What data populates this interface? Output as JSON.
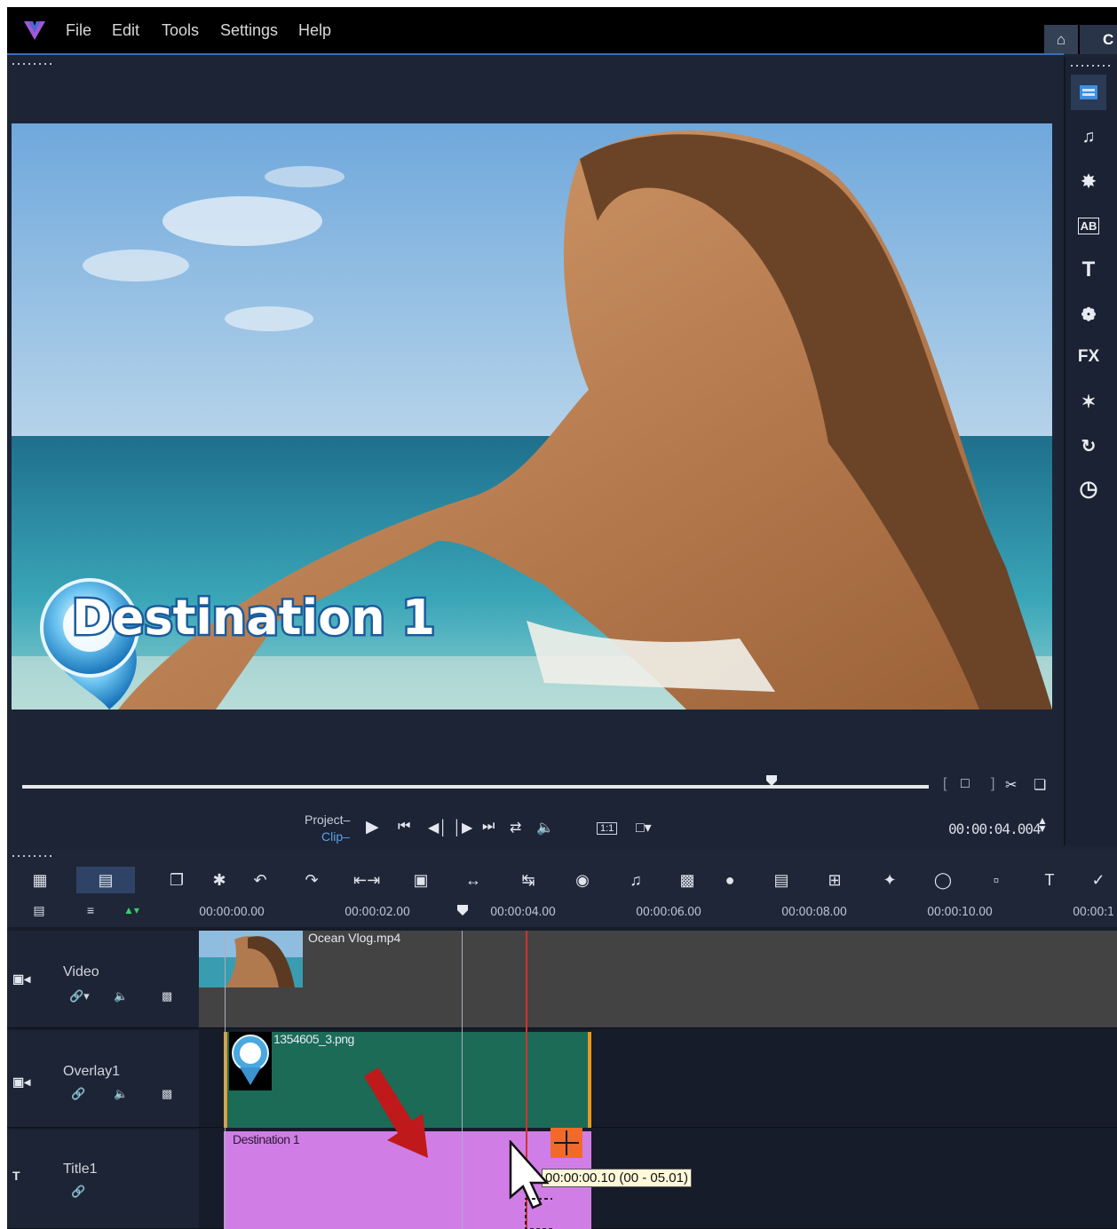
{
  "menu": {
    "items": [
      {
        "label": "File"
      },
      {
        "label": "Edit"
      },
      {
        "label": "Tools"
      },
      {
        "label": "Settings"
      },
      {
        "label": "Help"
      }
    ],
    "next_tab_letter": "C"
  },
  "player": {
    "overlay_title": "Destination 1",
    "project_label": "Project–",
    "clip_label": "Clip–",
    "timecode": "00:00:04.004",
    "aspect_label": "1:1"
  },
  "sidebar": {
    "items": [
      {
        "icon": "media-library-icon"
      },
      {
        "icon": "music-icon"
      },
      {
        "icon": "instant-project-icon"
      },
      {
        "icon": "transition-icon",
        "glyph": "AB"
      },
      {
        "icon": "title-icon",
        "glyph": "T"
      },
      {
        "icon": "graphics-icon"
      },
      {
        "icon": "filter-icon",
        "glyph": "FX"
      },
      {
        "icon": "effects-icon"
      },
      {
        "icon": "path-icon"
      },
      {
        "icon": "speed-icon"
      }
    ]
  },
  "timeline": {
    "ruler": [
      "00:00:00.00",
      "00:00:02.00",
      "00:00:04.00",
      "00:00:06.00",
      "00:00:08.00",
      "00:00:10.00",
      "00:00:1"
    ],
    "tracks": [
      {
        "name": "Video",
        "clip": "Ocean Vlog.mp4"
      },
      {
        "name": "Overlay1",
        "clip": "1354605_3.png"
      },
      {
        "name": "Title1",
        "clip": "Destination 1"
      }
    ],
    "tooltip": "00:00:00.10 (00 - 05.01)"
  },
  "colors": {
    "app_bg": "#1c2436",
    "accent": "#3a6fb8",
    "overlay_clip": "#1b6b57",
    "title_clip": "#d07ee6",
    "playhead": "#d13232",
    "arrow": "#c0191b"
  }
}
